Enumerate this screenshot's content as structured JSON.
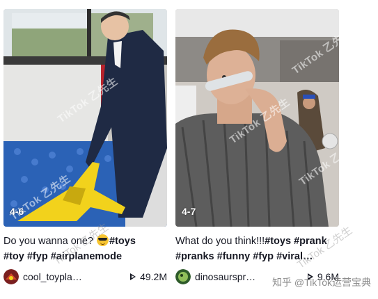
{
  "watermark": "TikTok 乙先生",
  "footer_watermark": "知乎 @TikTok运营宝典",
  "cards": [
    {
      "badge": "4-6",
      "desc_text": "Do you wanna one? ",
      "emoji": "sunglasses-emoji",
      "tags": [
        "#toys",
        "#toy",
        "#fyp",
        "#airplanemode"
      ],
      "username": "cool_toypla…",
      "plays": "49.2M"
    },
    {
      "badge": "4-7",
      "desc_text": "What do you think!!!",
      "tags": [
        "#toys",
        "#prank",
        "#pranks",
        "#funny",
        "#fyp",
        "#viral…"
      ],
      "username": "dinosaurspr…",
      "plays": "9.6M"
    }
  ],
  "colors": {
    "text": "#161823",
    "accent_yellow": "#f2d21c",
    "ball_blue": "#2b62b6"
  }
}
